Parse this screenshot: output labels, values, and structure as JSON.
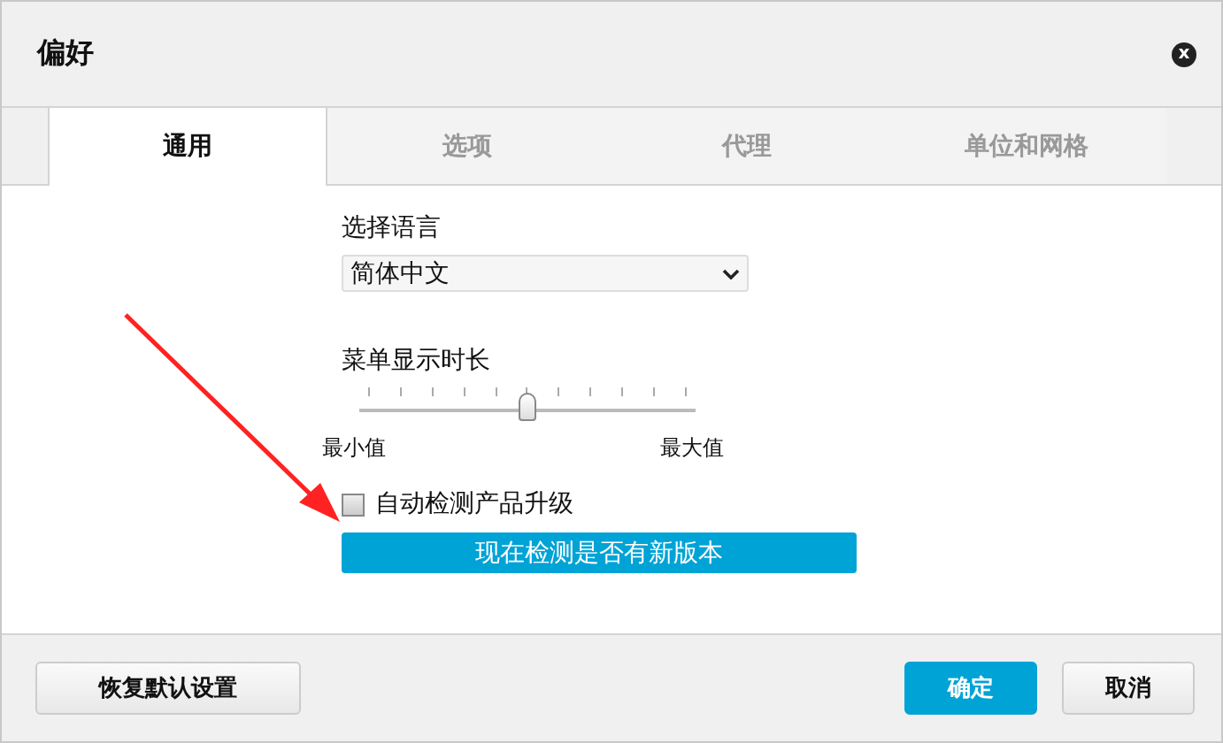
{
  "window": {
    "title": "偏好",
    "close": "x"
  },
  "tabs": [
    {
      "label": "通用",
      "selected": true
    },
    {
      "label": "选项",
      "selected": false
    },
    {
      "label": "代理",
      "selected": false
    },
    {
      "label": "单位和网格",
      "selected": false
    }
  ],
  "language": {
    "label": "选择语言",
    "value": "简体中文"
  },
  "menu_duration": {
    "label": "菜单显示时长",
    "level": 0.5,
    "min_label": "最小值",
    "max_label": "最大值"
  },
  "auto_check": {
    "label": "自动检测产品升级",
    "checked": false
  },
  "check_now_button": "现在检测是否有新版本",
  "footer": {
    "restore_button": "恢复默认设置",
    "ok_button": "确定",
    "cancel_button": "取消"
  }
}
